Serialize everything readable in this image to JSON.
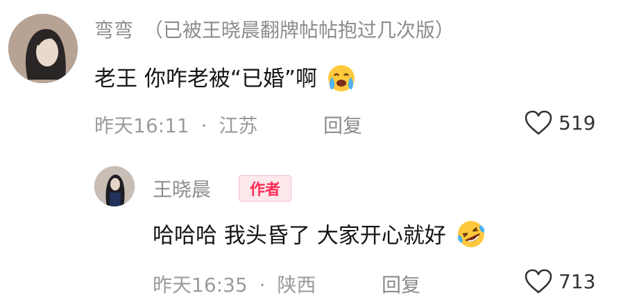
{
  "comment": {
    "author": "弯弯",
    "author_note": "（已被王晓晨翻牌帖帖抱过几次版）",
    "text": "老王 你咋老被“已婚”啊",
    "emoji": "crying-face-emoji",
    "time": "昨天16:11",
    "separator": "·",
    "location": "江苏",
    "reply_label": "回复",
    "like_count": "519"
  },
  "reply": {
    "author": "王晓晨",
    "badge": "作者",
    "text": "哈哈哈 我头昏了 大家开心就好",
    "emoji": "rolling-laughing-emoji",
    "time": "昨天16:35",
    "separator": "·",
    "location": "陕西",
    "reply_label": "回复",
    "like_count": "713"
  },
  "colors": {
    "author_badge_text": "#fe2c55",
    "meta_text": "#9b9b9b",
    "emoji_yellow": "#ffc83d",
    "emoji_tear": "#4fb3f0"
  }
}
